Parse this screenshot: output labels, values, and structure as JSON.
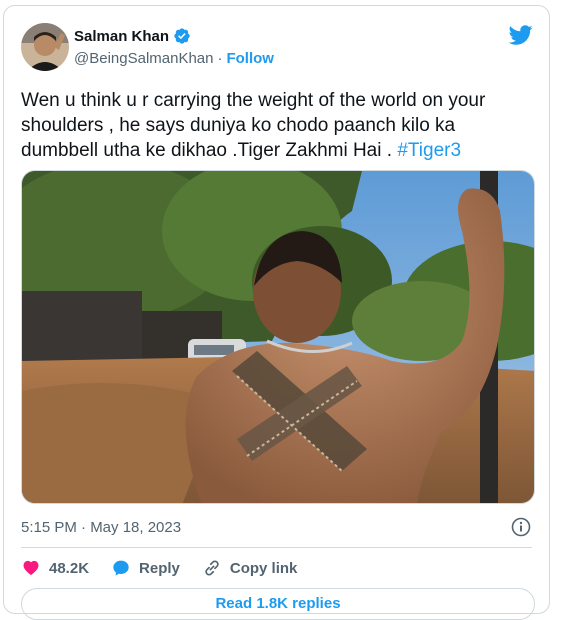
{
  "author": {
    "display_name": "Salman Khan",
    "handle": "@BeingSalmanKhan",
    "separator": "·",
    "follow_label": "Follow",
    "verified": true
  },
  "tweet": {
    "text_before": "Wen u think u r carrying the weight of the world on your shoulders , he says duniya ko chodo paanch kilo ka dumbbell utha ke dikhao .Tiger Zakhmi Hai . ",
    "hashtag": "#Tiger3",
    "timestamp": "5:15 PM · May 18, 2023"
  },
  "actions": {
    "likes_count": "48.2K",
    "reply_label": "Reply",
    "copy_link_label": "Copy link",
    "read_replies_label": "Read 1.8K replies"
  },
  "colors": {
    "accent": "#1d9bf0",
    "like": "#f91880",
    "text": "#0f1419",
    "muted": "#536471",
    "border": "#cfd9de"
  },
  "icons": [
    "verified-badge-icon",
    "twitter-bird-icon",
    "info-icon",
    "heart-icon",
    "reply-bubble-icon",
    "link-icon"
  ]
}
